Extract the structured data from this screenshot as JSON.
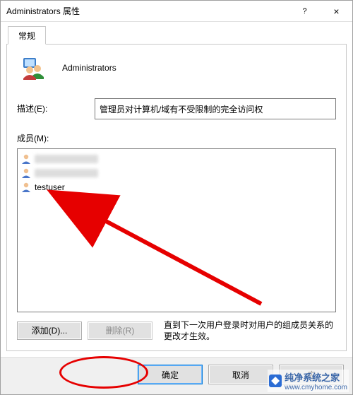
{
  "window": {
    "title": "Administrators 属性",
    "help_label": "?",
    "close_label": "×"
  },
  "tab": {
    "label": "常规"
  },
  "group": {
    "name": "Administrators"
  },
  "description": {
    "label": "描述(E):",
    "value": "管理员对计算机/域有不受限制的完全访问权"
  },
  "members": {
    "label": "成员(M):",
    "items": [
      {
        "name": "",
        "blurred": true
      },
      {
        "name": "",
        "blurred": true
      },
      {
        "name": "testuser",
        "blurred": false
      }
    ]
  },
  "buttons": {
    "add": "添加(D)...",
    "remove": "删除(R)",
    "note": "直到下一次用户登录时对用户的组成员关系的更改才生效。",
    "ok": "确定",
    "cancel": "取消",
    "apply": "应"
  },
  "watermark": {
    "name": "纯净系统之家",
    "url": "www.cmyhome.com"
  },
  "colors": {
    "accent_red": "#e60000"
  }
}
